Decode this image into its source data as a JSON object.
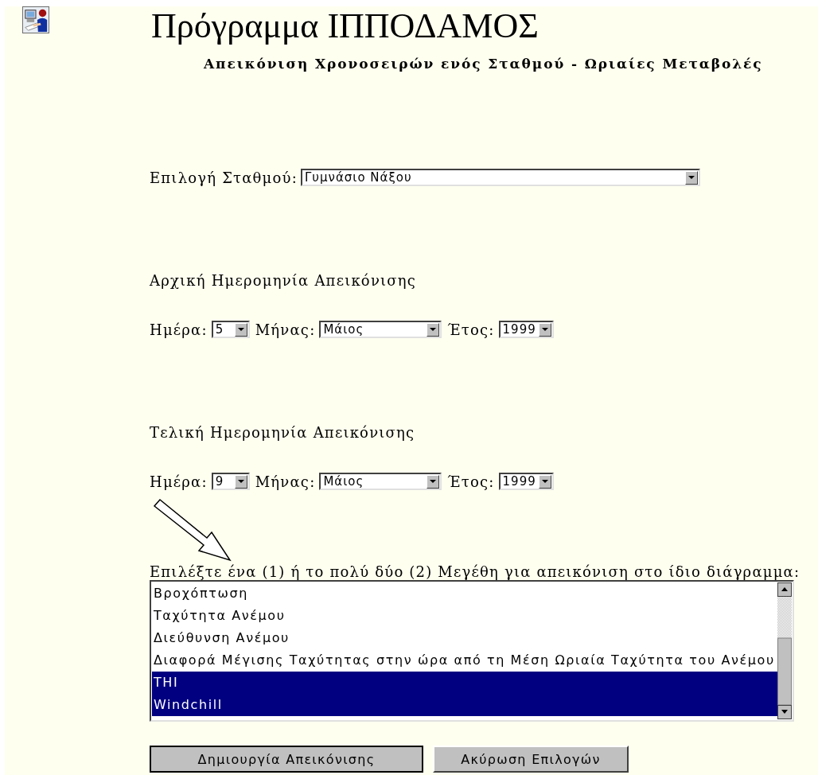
{
  "header": {
    "title": "Πρόγραμμα ΙΠΠΟΔΑΜΟΣ",
    "subtitle": "Απεικόνιση Χρονοσειρών ενός Σταθμού - Ωριαίες Μεταβολές"
  },
  "station": {
    "label": "Επιλογή Σταθμού:",
    "value": "Γυμνάσιο Νάξου"
  },
  "start_date": {
    "heading": "Αρχική Ημερομηνία Απεικόνισης",
    "day_label": "Ημέρα:",
    "day": "5",
    "month_label": "Μήνας:",
    "month": "Μάιος",
    "year_label": "Έτος:",
    "year": "1999"
  },
  "end_date": {
    "heading": "Τελική Ημερομηνία Απεικόνισης",
    "day_label": "Ημέρα:",
    "day": "9",
    "month_label": "Μήνας:",
    "month": "Μάιος",
    "year_label": "Έτος:",
    "year": "1999"
  },
  "variables": {
    "label": "Επιλέξτε ένα (1) ή το πολύ δύο (2) Μεγέθη για απεικόνιση στο ίδιο διάγραμμα:",
    "items": [
      {
        "text": "Βροχόπτωση",
        "selected": false
      },
      {
        "text": "Ταχύτητα Ανέμου",
        "selected": false
      },
      {
        "text": "Διεύθυνση Ανέμου",
        "selected": false
      },
      {
        "text": "Διαφορά Μέγισης Ταχύτητας στην ώρα από τη Μέση Ωριαία Ταχύτητα του Ανέμου",
        "selected": false
      },
      {
        "text": "THI",
        "selected": true
      },
      {
        "text": "Windchill",
        "selected": true
      }
    ]
  },
  "buttons": [
    "Δημιουργία Απεικόνισης",
    "Ακύρωση Επιλογών"
  ]
}
